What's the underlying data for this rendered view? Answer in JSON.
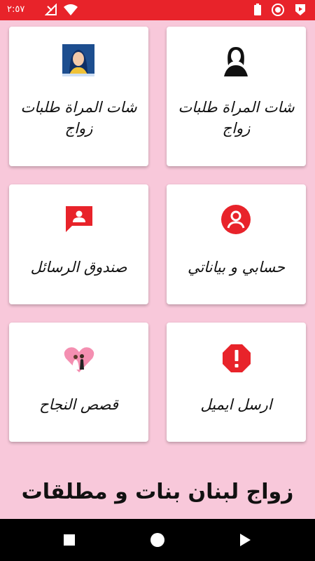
{
  "status_bar": {
    "time": "٢:٥٧"
  },
  "cards": {
    "chat_women_2": {
      "title": "شات المراة طلبات زواج",
      "icon": "woman-photo-icon"
    },
    "chat_women_1": {
      "title": "شات المراة طلبات زواج",
      "icon": "woman-silhouette-icon"
    },
    "inbox": {
      "title": "صندوق الرسائل",
      "icon": "message-user-icon"
    },
    "account": {
      "title": "حسابي و بياناتي",
      "icon": "account-circle-icon"
    },
    "success": {
      "title": "قصص النجاح",
      "icon": "couple-heart-icon"
    },
    "email": {
      "title": "ارسل ايميل",
      "icon": "alert-octagon-icon"
    }
  },
  "footer": {
    "title": "زواج لبنان بنات و مطلقات"
  },
  "colors": {
    "accent": "#e8232a",
    "background": "#f8c8da"
  }
}
